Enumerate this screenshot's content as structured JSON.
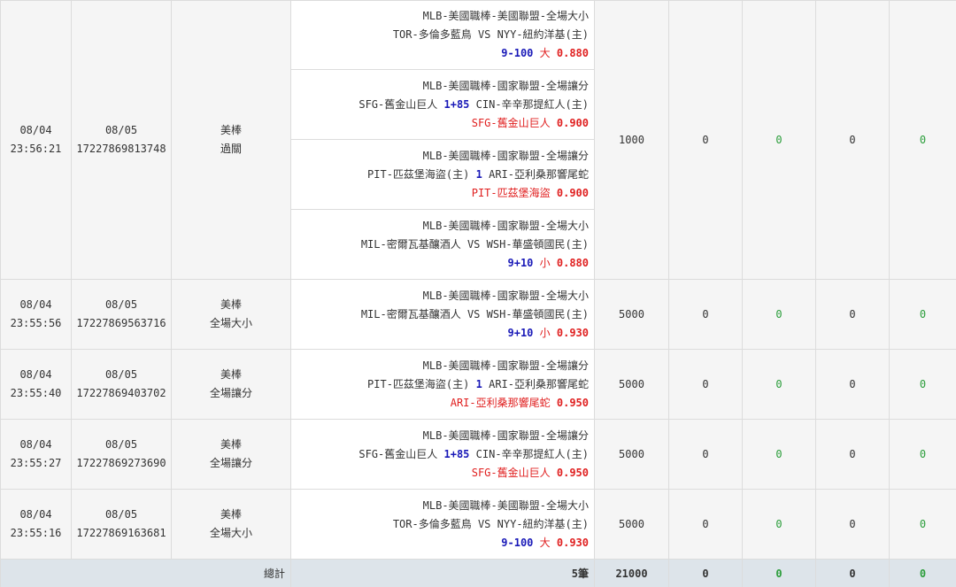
{
  "rows": [
    {
      "date": "08/04",
      "time": "23:56:21",
      "settle_date": "08/05",
      "ticket": "17227869813748",
      "sport": "美棒",
      "bet_type": "過關",
      "stake": "1000",
      "c1": "0",
      "c2": "0",
      "c3": "0",
      "c4": "0",
      "details": [
        {
          "league": "MLB-美國職棒-美國聯盟-全場大小",
          "home": "TOR-多倫多藍鳥",
          "line": "",
          "vs": " VS ",
          "away": "NYY-紐約洋基(主)",
          "pick_a": "9-100",
          "pick_b": " 大",
          "odds": "0.880"
        },
        {
          "league": "MLB-美國職棒-國家聯盟-全場讓分",
          "home": "SFG-舊金山巨人",
          "line": "1+85",
          "vs": "CIN-辛辛那提紅人(主)",
          "away": "",
          "pick_a": "",
          "pick_b": "SFG-舊金山巨人",
          "odds": "0.900"
        },
        {
          "league": "MLB-美國職棒-國家聯盟-全場讓分",
          "home": "PIT-匹茲堡海盜(主)",
          "line": "1",
          "vs": "ARI-亞利桑那響尾蛇",
          "away": "",
          "pick_a": "",
          "pick_b": "PIT-匹茲堡海盜",
          "odds": "0.900"
        },
        {
          "league": "MLB-美國職棒-國家聯盟-全場大小",
          "home": "MIL-密爾瓦基釀酒人",
          "line": "",
          "vs": " VS ",
          "away": "WSH-華盛頓國民(主)",
          "pick_a": "9+10",
          "pick_b": " 小",
          "odds": "0.880"
        }
      ]
    },
    {
      "date": "08/04",
      "time": "23:55:56",
      "settle_date": "08/05",
      "ticket": "17227869563716",
      "sport": "美棒",
      "bet_type": "全場大小",
      "stake": "5000",
      "c1": "0",
      "c2": "0",
      "c3": "0",
      "c4": "0",
      "details": [
        {
          "league": "MLB-美國職棒-國家聯盟-全場大小",
          "home": "MIL-密爾瓦基釀酒人",
          "line": "",
          "vs": " VS ",
          "away": "WSH-華盛頓國民(主)",
          "pick_a": "9+10",
          "pick_b": " 小",
          "odds": "0.930"
        }
      ]
    },
    {
      "date": "08/04",
      "time": "23:55:40",
      "settle_date": "08/05",
      "ticket": "17227869403702",
      "sport": "美棒",
      "bet_type": "全場讓分",
      "stake": "5000",
      "c1": "0",
      "c2": "0",
      "c3": "0",
      "c4": "0",
      "details": [
        {
          "league": "MLB-美國職棒-國家聯盟-全場讓分",
          "home": "PIT-匹茲堡海盜(主)",
          "line": "1",
          "vs": "ARI-亞利桑那響尾蛇",
          "away": "",
          "pick_a": "",
          "pick_b": "ARI-亞利桑那響尾蛇",
          "odds": "0.950"
        }
      ]
    },
    {
      "date": "08/04",
      "time": "23:55:27",
      "settle_date": "08/05",
      "ticket": "17227869273690",
      "sport": "美棒",
      "bet_type": "全場讓分",
      "stake": "5000",
      "c1": "0",
      "c2": "0",
      "c3": "0",
      "c4": "0",
      "details": [
        {
          "league": "MLB-美國職棒-國家聯盟-全場讓分",
          "home": "SFG-舊金山巨人",
          "line": "1+85",
          "vs": "CIN-辛辛那提紅人(主)",
          "away": "",
          "pick_a": "",
          "pick_b": "SFG-舊金山巨人",
          "odds": "0.950"
        }
      ]
    },
    {
      "date": "08/04",
      "time": "23:55:16",
      "settle_date": "08/05",
      "ticket": "17227869163681",
      "sport": "美棒",
      "bet_type": "全場大小",
      "stake": "5000",
      "c1": "0",
      "c2": "0",
      "c3": "0",
      "c4": "0",
      "details": [
        {
          "league": "MLB-美國職棒-美國聯盟-全場大小",
          "home": "TOR-多倫多藍鳥",
          "line": "",
          "vs": " VS ",
          "away": "NYY-紐約洋基(主)",
          "pick_a": "9-100",
          "pick_b": " 大",
          "odds": "0.930"
        }
      ]
    }
  ],
  "total": {
    "label": "總計",
    "count": "5筆",
    "stake": "21000",
    "c1": "0",
    "c2": "0",
    "c3": "0",
    "c4": "0"
  },
  "colors": {
    "blue": "#1a1ab8",
    "red": "#e02020",
    "green": "#2a9d3a",
    "total_bg": "#dde4ea"
  }
}
